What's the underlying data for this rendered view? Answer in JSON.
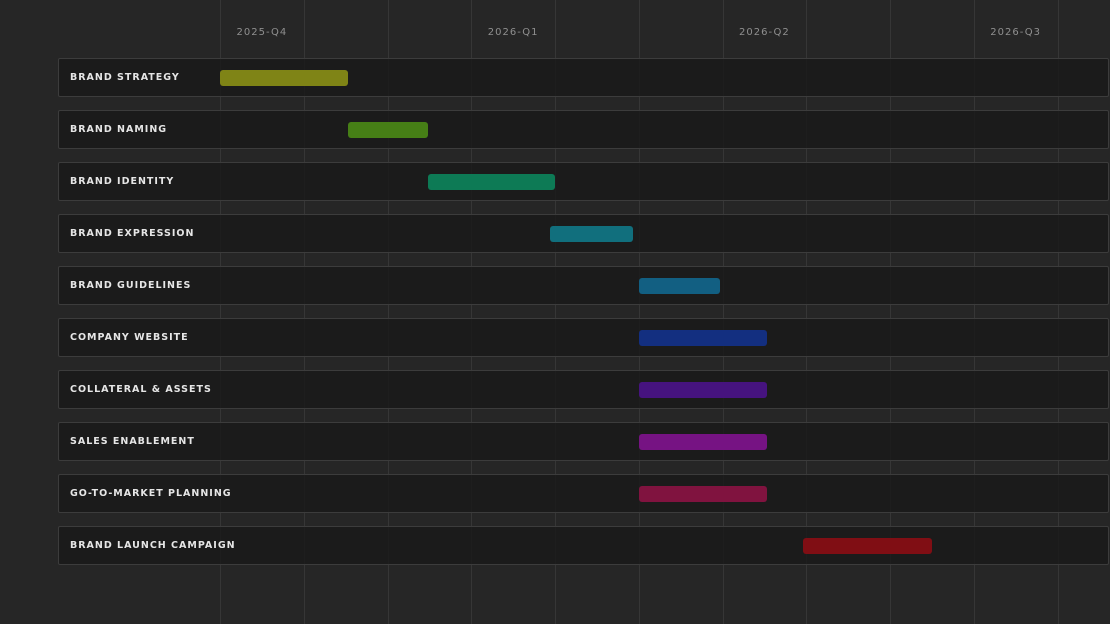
{
  "chart_data": {
    "type": "gantt",
    "x_axis": {
      "quarters": [
        "2025-Q4",
        "2026-Q1",
        "2026-Q2",
        "2026-Q3"
      ]
    },
    "tasks": [
      {
        "label": "BRAND STRATEGY",
        "start": "2025-10-01",
        "end": "2025-11-17",
        "color": "#7f8416"
      },
      {
        "label": "BRAND NAMING",
        "start": "2025-11-17",
        "end": "2025-12-16",
        "color": "#467f16"
      },
      {
        "label": "BRAND IDENTITY",
        "start": "2025-12-16",
        "end": "2026-02-01",
        "color": "#0d7a55"
      },
      {
        "label": "BRAND EXPRESSION",
        "start": "2026-01-30",
        "end": "2026-02-27",
        "color": "#116f7d"
      },
      {
        "label": "BRAND GUIDELINES",
        "start": "2026-03-01",
        "end": "2026-03-31",
        "color": "#125f82"
      },
      {
        "label": "COMPANY WEBSITE",
        "start": "2026-03-01",
        "end": "2026-04-17",
        "color": "#132f80"
      },
      {
        "label": "COLLATERAL & ASSETS",
        "start": "2026-03-01",
        "end": "2026-04-17",
        "color": "#46137f"
      },
      {
        "label": "SALES ENABLEMENT",
        "start": "2026-03-01",
        "end": "2026-04-17",
        "color": "#761383"
      },
      {
        "label": "GO-TO-MARKET PLANNING",
        "start": "2026-03-01",
        "end": "2026-04-17",
        "color": "#80133f"
      },
      {
        "label": "BRAND LAUNCH CAMPAIGN",
        "start": "2026-04-30",
        "end": "2026-06-16",
        "color": "#800e14"
      }
    ]
  }
}
